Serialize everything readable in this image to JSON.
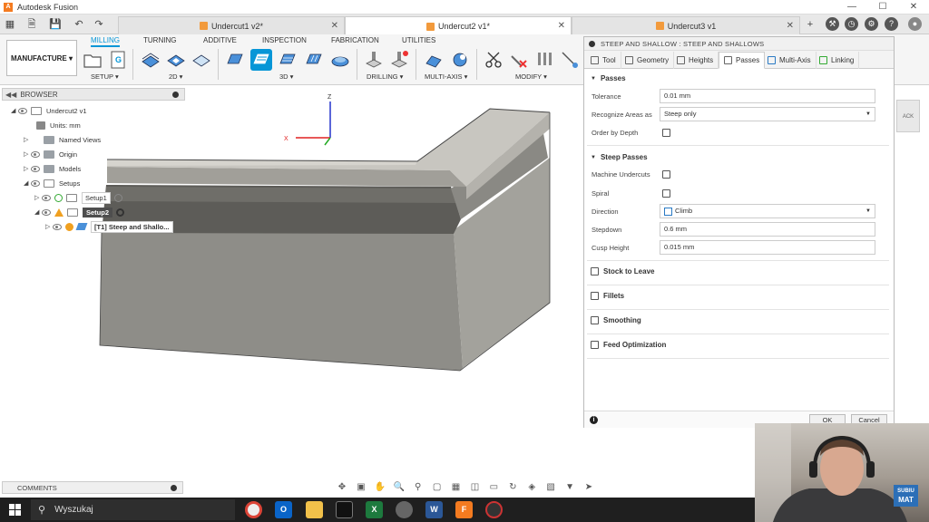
{
  "window": {
    "app_title": "Autodesk Fusion",
    "logo_letter": "A",
    "controls": [
      "—",
      "☐",
      "✕"
    ]
  },
  "tabs": [
    {
      "label": "Undercut1 v2*",
      "active": false
    },
    {
      "label": "Undercut2 v1*",
      "active": true
    },
    {
      "label": "Undercut3 v1",
      "active": false
    }
  ],
  "ribbon": {
    "workspace": "MANUFACTURE ▾",
    "tabs": [
      "MILLING",
      "TURNING",
      "ADDITIVE",
      "INSPECTION",
      "FABRICATION",
      "UTILITIES"
    ],
    "groups": [
      "SETUP ▾",
      "2D ▾",
      "3D ▾",
      "DRILLING ▾",
      "MULTI-AXIS ▾",
      "MODIFY ▾"
    ]
  },
  "browser": {
    "header": "BROWSER",
    "items": [
      {
        "label": "Undercut2 v1"
      },
      {
        "label": "Units: mm"
      },
      {
        "label": "Named Views"
      },
      {
        "label": "Origin"
      },
      {
        "label": "Models"
      },
      {
        "label": "Setups"
      },
      {
        "label": "Setup1"
      },
      {
        "label": "Setup2"
      },
      {
        "label": "[T1] Steep and Shallo..."
      }
    ]
  },
  "viewport": {
    "axis_z": "Z",
    "axis_x": "X"
  },
  "dialog": {
    "title": "STEEP AND SHALLOW : STEEP AND SHALLOWS",
    "tabs": [
      "Tool",
      "Geometry",
      "Heights",
      "Passes",
      "Multi-Axis",
      "Linking"
    ],
    "active_tab": "Passes",
    "passes": {
      "section": "Passes",
      "tolerance_label": "Tolerance",
      "tolerance_value": "0.01 mm",
      "recognize_label": "Recognize Areas as",
      "recognize_value": "Steep only",
      "order_label": "Order by Depth",
      "order_checked": false
    },
    "steep": {
      "section": "Steep Passes",
      "undercuts_label": "Machine Undercuts",
      "undercuts_checked": false,
      "spiral_label": "Spiral",
      "spiral_checked": false,
      "direction_label": "Direction",
      "direction_value": "Climb",
      "stepdown_label": "Stepdown",
      "stepdown_value": "0.6 mm",
      "cusp_label": "Cusp Height",
      "cusp_value": "0.015 mm"
    },
    "collapsed": [
      "Stock to Leave",
      "Fillets",
      "Smoothing",
      "Feed Optimization"
    ],
    "ok": "OK",
    "cancel": "Cancel",
    "info_glyph": "i"
  },
  "viewcube_label": "ACK",
  "comments": {
    "label": "COMMENTS"
  },
  "overlay_badge": {
    "line1": "SUBIU",
    "line2": "MAT"
  },
  "taskbar": {
    "search_placeholder": "Wyszukaj",
    "fusion_label": "F"
  },
  "colors": {
    "accent": "#0696d7",
    "brand": "#f47b20",
    "selected_bg": "#4e4e4e"
  }
}
